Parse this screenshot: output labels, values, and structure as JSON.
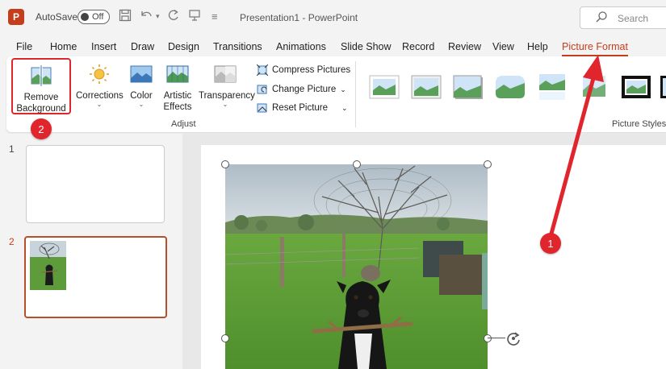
{
  "titlebar": {
    "app_icon": "P",
    "autosave_label": "AutoSave",
    "autosave_state": "Off",
    "document_title": "Presentation1  -  PowerPoint",
    "search_placeholder": "Search"
  },
  "tabs": [
    {
      "label": "File",
      "active": false
    },
    {
      "label": "Home",
      "active": false
    },
    {
      "label": "Insert",
      "active": false
    },
    {
      "label": "Draw",
      "active": false
    },
    {
      "label": "Design",
      "active": false
    },
    {
      "label": "Transitions",
      "active": false
    },
    {
      "label": "Animations",
      "active": false
    },
    {
      "label": "Slide Show",
      "active": false
    },
    {
      "label": "Record",
      "active": false
    },
    {
      "label": "Review",
      "active": false
    },
    {
      "label": "View",
      "active": false
    },
    {
      "label": "Help",
      "active": false
    },
    {
      "label": "Picture Format",
      "active": true
    }
  ],
  "ribbon": {
    "remove_background": {
      "line1": "Remove",
      "line2": "Background"
    },
    "corrections": "Corrections",
    "color": "Color",
    "artistic_effects": {
      "line1": "Artistic",
      "line2": "Effects"
    },
    "transparency": "Transparency",
    "compress_pictures": "Compress Pictures",
    "change_picture": "Change Picture",
    "reset_picture": "Reset Picture",
    "adjust_group": "Adjust",
    "picture_styles_group": "Picture Styles"
  },
  "slides": [
    {
      "number": "1"
    },
    {
      "number": "2"
    }
  ],
  "callouts": {
    "step1": "1",
    "step2": "2"
  },
  "colors": {
    "accent": "#c43e1c",
    "callout": "#e0262c"
  }
}
